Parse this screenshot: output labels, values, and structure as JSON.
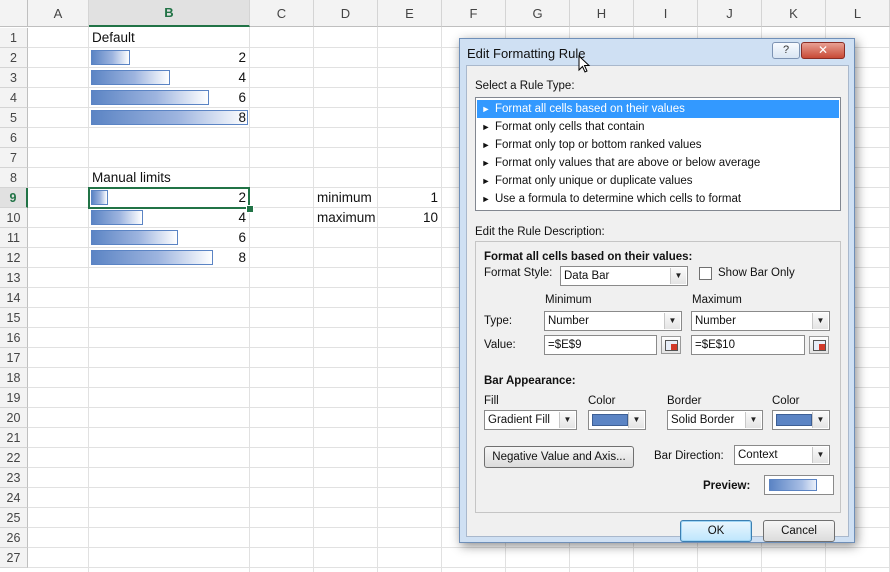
{
  "spreadsheet": {
    "columns": [
      "A",
      "B",
      "C",
      "D",
      "E",
      "F",
      "G",
      "H",
      "I",
      "J",
      "K",
      "L"
    ],
    "rows": [
      "1",
      "2",
      "3",
      "4",
      "5",
      "6",
      "7",
      "8",
      "9",
      "10",
      "11",
      "12",
      "13",
      "14",
      "15",
      "16",
      "17",
      "18",
      "19",
      "20",
      "21",
      "22",
      "23",
      "24",
      "25",
      "26",
      "27"
    ],
    "selected_column": "B",
    "selected_row": "9",
    "cells": {
      "B1": "Default",
      "B2": "2",
      "B3": "4",
      "B4": "6",
      "B5": "8",
      "B8": "Manual limits",
      "B9": "2",
      "B10": "4",
      "B11": "6",
      "B12": "8",
      "D9": "minimum",
      "E9": "1",
      "D10": "maximum",
      "E10": "10"
    },
    "data_bar_fractions": {
      "default": [
        0.25,
        0.5,
        0.75,
        1.0
      ],
      "manual": [
        0.111,
        0.333,
        0.556,
        0.778
      ]
    },
    "bar_color": "#5b84c4"
  },
  "dialog": {
    "title": "Edit Formatting Rule",
    "help_label": "?",
    "close_label": "✕",
    "select_rule_type_label": "Select a Rule Type:",
    "rule_types": [
      "Format all cells based on their values",
      "Format only cells that contain",
      "Format only top or bottom ranked values",
      "Format only values that are above or below average",
      "Format only unique or duplicate values",
      "Use a formula to determine which cells to format"
    ],
    "selected_rule_index": 0,
    "edit_description_label": "Edit the Rule Description:",
    "format_all_heading": "Format all cells based on their values:",
    "format_style_label": "Format Style:",
    "format_style_value": "Data Bar",
    "show_bar_only_label": "Show Bar Only",
    "show_bar_only_checked": false,
    "minimum_header": "Minimum",
    "maximum_header": "Maximum",
    "type_label": "Type:",
    "value_label": "Value:",
    "min_type": "Number",
    "max_type": "Number",
    "min_value": "=$E$9",
    "max_value": "=$E$10",
    "bar_appearance_label": "Bar Appearance:",
    "fill_label": "Fill",
    "fill_color_label": "Color",
    "border_label": "Border",
    "border_color_label": "Color",
    "fill_value": "Gradient Fill",
    "border_value": "Solid Border",
    "negative_button": "Negative Value and Axis...",
    "bar_direction_label": "Bar Direction:",
    "bar_direction_value": "Context",
    "preview_label": "Preview:",
    "ok_label": "OK",
    "cancel_label": "Cancel"
  }
}
